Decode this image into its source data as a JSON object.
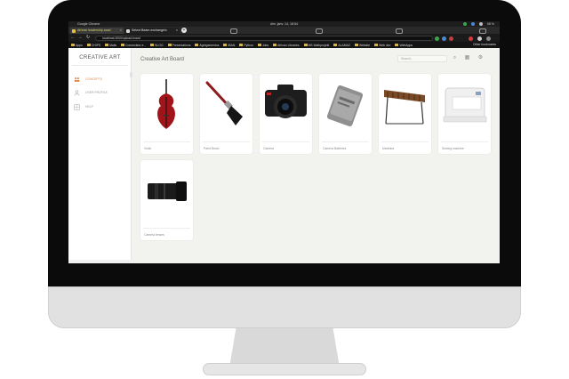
{
  "os": {
    "app_name": "Google Chrome",
    "clock": "dim. janv. 14, 18:54",
    "battery": "98 %"
  },
  "browser": {
    "tabs": [
      {
        "label": "African leadership acad",
        "active": true
      },
      {
        "label": "Select Beam exchange/c",
        "active": false
      }
    ],
    "new_tab_symbol": "+",
    "url": "localhost:3000/upload-board",
    "bookmarks": [
      "Apps",
      "CHIPS",
      "Mails",
      "Connecteur e...",
      "BLOG",
      "Presentations",
      "Agrégamentos",
      "IBAN",
      "Python",
      "Jobs",
      "African Libraries",
      "MS Mathprojekt",
      "ALAMAZ",
      "Website",
      "Web dev",
      "WebApps"
    ],
    "other_bookmarks": "Other bookmarks"
  },
  "app": {
    "brand": "CREATIVE ART",
    "sidebar": [
      {
        "label": "CONCEPTS",
        "icon": "people-icon",
        "active": true
      },
      {
        "label": "USER PROFILE",
        "icon": "user-icon",
        "active": false
      },
      {
        "label": "HELP",
        "icon": "grid-icon",
        "active": false
      }
    ],
    "page_title": "Creative Art Board",
    "search_placeholder": "Search...",
    "toolbar_icons": [
      "search-icon",
      "filter-icon",
      "settings-icon"
    ],
    "cards": [
      {
        "label": "Violin",
        "icon": "violin-icon"
      },
      {
        "label": "Paint Brush",
        "icon": "paint-brush-icon"
      },
      {
        "label": "Camera",
        "icon": "camera-icon"
      },
      {
        "label": "Camera Batteries",
        "icon": "battery-icon"
      },
      {
        "label": "Marimba",
        "icon": "marimba-icon"
      },
      {
        "label": "Sewing machine",
        "icon": "sewing-machine-icon"
      },
      {
        "label": "Camera lenses",
        "icon": "lens-icon"
      }
    ]
  },
  "colors": {
    "accent": "#e08a4a",
    "background": "#f2f2ef",
    "bezel": "#0b0b0b"
  }
}
